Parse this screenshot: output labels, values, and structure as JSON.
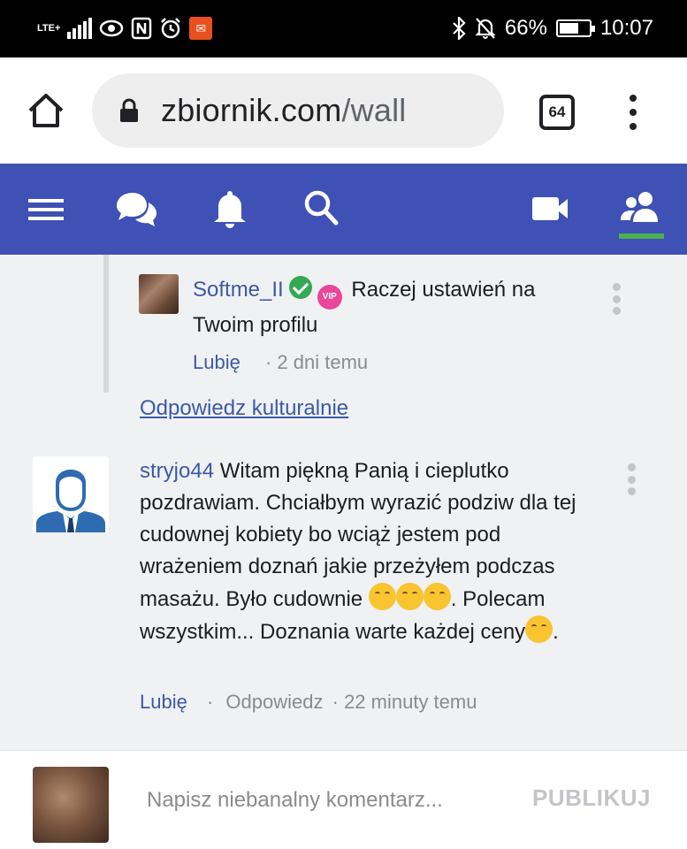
{
  "status_bar": {
    "network": "LTE+",
    "battery": "66%",
    "battery_level": 0.66,
    "time": "10:07",
    "icons": [
      "signal-icon",
      "eye-icon",
      "nfc-icon",
      "alarm-icon",
      "app-notification-icon",
      "bluetooth-icon",
      "mute-icon",
      "battery-icon"
    ]
  },
  "browser": {
    "url_host": "zbiornik.com",
    "url_path": "/wall",
    "tab_count": "64"
  },
  "nav": {
    "items": [
      "menu-icon",
      "chat-icon",
      "bell-icon",
      "search-icon",
      "video-icon",
      "friends-icon"
    ],
    "active": "friends-icon",
    "active_color": "#4caf50",
    "bar_color": "#3f51b5"
  },
  "reply": {
    "username": "Softme_II",
    "text": " Raczej ustawień na Twoim profilu",
    "like": "Lubię",
    "time": "· 2 dni temu",
    "badge_vip": "VIP"
  },
  "reply_link": "Odpowiedz kulturalnie",
  "comment": {
    "username": "stryjo44",
    "text_part1": " Witam piękną Panią i cieplutko pozdrawiam. Chciałbym wyrazić podziw dla tej cudownej kobiety bo wciąż jestem pod wrażeniem doznań jakie przeżyłem podczas masażu. Było cudownie ",
    "text_part2": ". Polecam wszystkim... Doznania warte każdej ceny",
    "text_part3": ".",
    "like": "Lubię",
    "reply": "Odpowiedz",
    "time": "· 22 minuty temu"
  },
  "composer": {
    "placeholder": "Napisz niebanalny komentarz...",
    "publish": "PUBLIKUJ"
  },
  "colors": {
    "link": "#3b5aa6",
    "verified": "#34a853",
    "vip": "#e8479a"
  }
}
